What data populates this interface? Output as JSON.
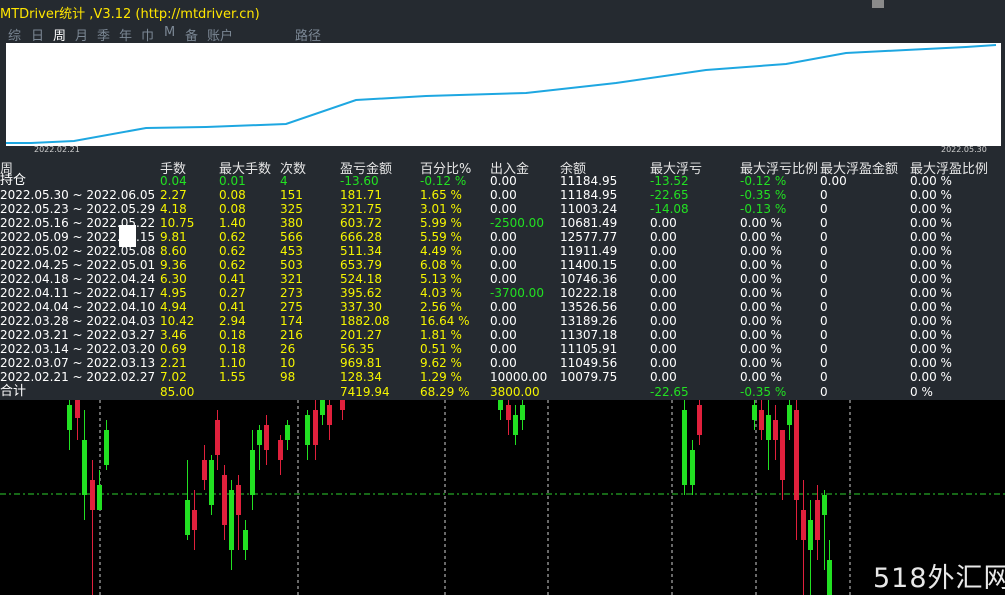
{
  "window": {
    "title": "MTDriver统计  ,V3.12 (http://mtdriver.cn)"
  },
  "tabs": [
    {
      "label": "综",
      "active": false
    },
    {
      "label": "日",
      "active": false
    },
    {
      "label": "周",
      "active": true
    },
    {
      "label": "月",
      "active": false
    },
    {
      "label": "季",
      "active": false
    },
    {
      "label": "年",
      "active": false
    },
    {
      "label": "巾",
      "active": false
    },
    {
      "label": "M",
      "active": false
    },
    {
      "label": "备",
      "active": false
    },
    {
      "label": "账户",
      "active": false
    },
    {
      "label": "路径",
      "active": false
    }
  ],
  "equity_chart": {
    "x_start_label": "2022.02.21",
    "x_end_label": "2022.05.30",
    "line_color": "#1ea7e1"
  },
  "table": {
    "headers": [
      "周",
      "手数",
      "最大手数",
      "次数",
      "盈亏金额",
      "百分比%",
      "出入金",
      "余额",
      "最大浮亏",
      "最大浮亏比例",
      "最大浮盈金额",
      "最大浮盈比例"
    ],
    "rows": [
      {
        "period": "持仓",
        "lots": "0.04",
        "max_lots": "0.01",
        "count": "4",
        "pnl": "-13.60",
        "pct": "-0.12 %",
        "cash": "0.00",
        "balance": "11184.95",
        "max_dd": "-13.52",
        "max_dd_pct": "-0.12 %",
        "max_fp": "0.00",
        "max_fp_pct": "0.00 %",
        "green": true
      },
      {
        "period": "2022.05.30 ~ 2022.06.05",
        "lots": "2.27",
        "max_lots": "0.08",
        "count": "151",
        "pnl": "181.71",
        "pct": "1.65 %",
        "cash": "0.00",
        "balance": "11184.95",
        "max_dd": "-22.65",
        "max_dd_pct": "-0.35 %",
        "max_fp": "0",
        "max_fp_pct": "0.00 %"
      },
      {
        "period": "2022.05.23 ~ 2022.05.29",
        "lots": "4.18",
        "max_lots": "0.08",
        "count": "325",
        "pnl": "321.75",
        "pct": "3.01 %",
        "cash": "0.00",
        "balance": "11003.24",
        "max_dd": "-14.08",
        "max_dd_pct": "-0.13 %",
        "max_fp": "0",
        "max_fp_pct": "0.00 %"
      },
      {
        "period": "2022.05.16 ~ 2022.05.22",
        "lots": "10.75",
        "max_lots": "1.40",
        "count": "380",
        "pnl": "603.72",
        "pct": "5.99 %",
        "cash": "-2500.00",
        "balance": "10681.49",
        "max_dd": "0.00",
        "max_dd_pct": "0.00 %",
        "max_fp": "0",
        "max_fp_pct": "0.00 %"
      },
      {
        "period": "2022.05.09 ~ 2022.05.15",
        "lots": "9.81",
        "max_lots": "0.62",
        "count": "566",
        "pnl": "666.28",
        "pct": "5.59 %",
        "cash": "0.00",
        "balance": "12577.77",
        "max_dd": "0.00",
        "max_dd_pct": "0.00 %",
        "max_fp": "0",
        "max_fp_pct": "0.00 %"
      },
      {
        "period": "2022.05.02 ~ 2022.05.08",
        "lots": "8.60",
        "max_lots": "0.62",
        "count": "453",
        "pnl": "511.34",
        "pct": "4.49 %",
        "cash": "0.00",
        "balance": "11911.49",
        "max_dd": "0.00",
        "max_dd_pct": "0.00 %",
        "max_fp": "0",
        "max_fp_pct": "0.00 %"
      },
      {
        "period": "2022.04.25 ~ 2022.05.01",
        "lots": "9.36",
        "max_lots": "0.62",
        "count": "503",
        "pnl": "653.79",
        "pct": "6.08 %",
        "cash": "0.00",
        "balance": "11400.15",
        "max_dd": "0.00",
        "max_dd_pct": "0.00 %",
        "max_fp": "0",
        "max_fp_pct": "0.00 %"
      },
      {
        "period": "2022.04.18 ~ 2022.04.24",
        "lots": "6.30",
        "max_lots": "0.41",
        "count": "321",
        "pnl": "524.18",
        "pct": "5.13 %",
        "cash": "0.00",
        "balance": "10746.36",
        "max_dd": "0.00",
        "max_dd_pct": "0.00 %",
        "max_fp": "0",
        "max_fp_pct": "0.00 %"
      },
      {
        "period": "2022.04.11 ~ 2022.04.17",
        "lots": "4.95",
        "max_lots": "0.27",
        "count": "273",
        "pnl": "395.62",
        "pct": "4.03 %",
        "cash": "-3700.00",
        "balance": "10222.18",
        "max_dd": "0.00",
        "max_dd_pct": "0.00 %",
        "max_fp": "0",
        "max_fp_pct": "0.00 %"
      },
      {
        "period": "2022.04.04 ~ 2022.04.10",
        "lots": "4.94",
        "max_lots": "0.41",
        "count": "275",
        "pnl": "337.30",
        "pct": "2.56 %",
        "cash": "0.00",
        "balance": "13526.56",
        "max_dd": "0.00",
        "max_dd_pct": "0.00 %",
        "max_fp": "0",
        "max_fp_pct": "0.00 %"
      },
      {
        "period": "2022.03.28 ~ 2022.04.03",
        "lots": "10.42",
        "max_lots": "2.94",
        "count": "174",
        "pnl": "1882.08",
        "pct": "16.64 %",
        "cash": "0.00",
        "balance": "13189.26",
        "max_dd": "0.00",
        "max_dd_pct": "0.00 %",
        "max_fp": "0",
        "max_fp_pct": "0.00 %"
      },
      {
        "period": "2022.03.21 ~ 2022.03.27",
        "lots": "3.46",
        "max_lots": "0.18",
        "count": "216",
        "pnl": "201.27",
        "pct": "1.81 %",
        "cash": "0.00",
        "balance": "11307.18",
        "max_dd": "0.00",
        "max_dd_pct": "0.00 %",
        "max_fp": "0",
        "max_fp_pct": "0.00 %"
      },
      {
        "period": "2022.03.14 ~ 2022.03.20",
        "lots": "0.69",
        "max_lots": "0.18",
        "count": "26",
        "pnl": "56.35",
        "pct": "0.51 %",
        "cash": "0.00",
        "balance": "11105.91",
        "max_dd": "0.00",
        "max_dd_pct": "0.00 %",
        "max_fp": "0",
        "max_fp_pct": "0.00 %"
      },
      {
        "period": "2022.03.07 ~ 2022.03.13",
        "lots": "2.21",
        "max_lots": "1.10",
        "count": "10",
        "pnl": "969.81",
        "pct": "9.62 %",
        "cash": "0.00",
        "balance": "11049.56",
        "max_dd": "0.00",
        "max_dd_pct": "0.00 %",
        "max_fp": "0",
        "max_fp_pct": "0.00 %"
      },
      {
        "period": "2022.02.21 ~ 2022.02.27",
        "lots": "7.02",
        "max_lots": "1.55",
        "count": "98",
        "pnl": "128.34",
        "pct": "1.29 %",
        "cash": "10000.00",
        "balance": "10079.75",
        "max_dd": "0.00",
        "max_dd_pct": "0.00 %",
        "max_fp": "0",
        "max_fp_pct": "0.00 %"
      }
    ],
    "total": {
      "period": "合计",
      "lots": "85.00",
      "max_lots": "",
      "count": "",
      "pnl": "7419.94",
      "pct": "68.29 %",
      "cash": "3800.00",
      "balance": "",
      "max_dd": "-22.65",
      "max_dd_pct": "-0.35 %",
      "max_fp": "0",
      "max_fp_pct": "0 %"
    }
  },
  "watermark": "518外汇网",
  "colors": {
    "panel_bg": "#252a30",
    "text_yellow": "#f5f500",
    "text_green": "#22e022",
    "title_yellow": "#ffe600",
    "bull": "#22e022",
    "bear": "#e0203c"
  }
}
